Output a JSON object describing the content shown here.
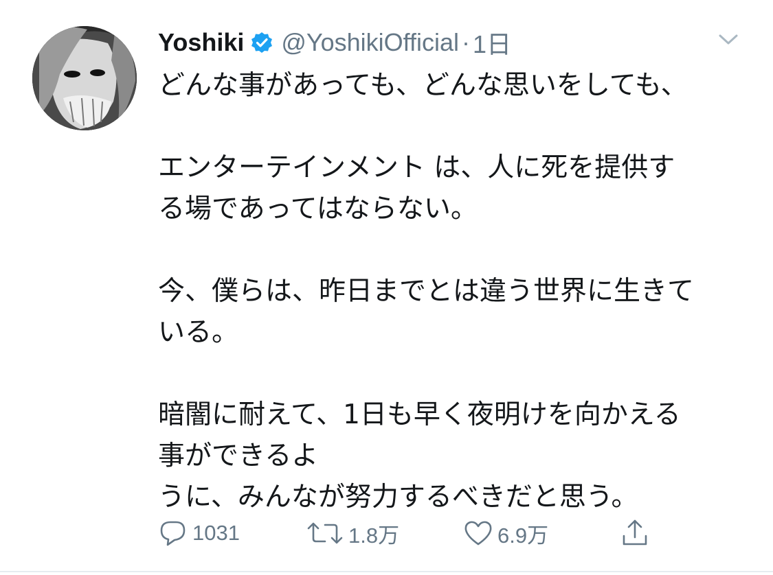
{
  "tweet": {
    "display_name": "Yoshiki",
    "handle": "@YoshikiOfficial",
    "separator": "·",
    "time": "1日",
    "lines": [
      "どんな事があっても、どんな思いをしても、",
      "",
      "エンターテインメント は、人に死を提供す",
      "る場であってはならない。",
      "",
      "今、僕らは、昨日までとは違う世界に生きて",
      "いる。",
      "",
      "暗闇に耐えて、1日も早く夜明けを向かえる",
      "事ができるよ",
      "うに、みんなが努力するべきだと思う。"
    ],
    "stats": {
      "replies": "1031",
      "retweets": "1.8万",
      "likes": "6.9万"
    }
  },
  "icons": {
    "verified": "verified-badge-icon",
    "menu": "chevron-down-icon",
    "reply": "reply-icon",
    "retweet": "retweet-icon",
    "like": "heart-icon",
    "share": "share-icon"
  },
  "colors": {
    "text": "#14171a",
    "secondary": "#657786",
    "verified_blue": "#1da1f2",
    "divider": "#e6ecf0"
  }
}
